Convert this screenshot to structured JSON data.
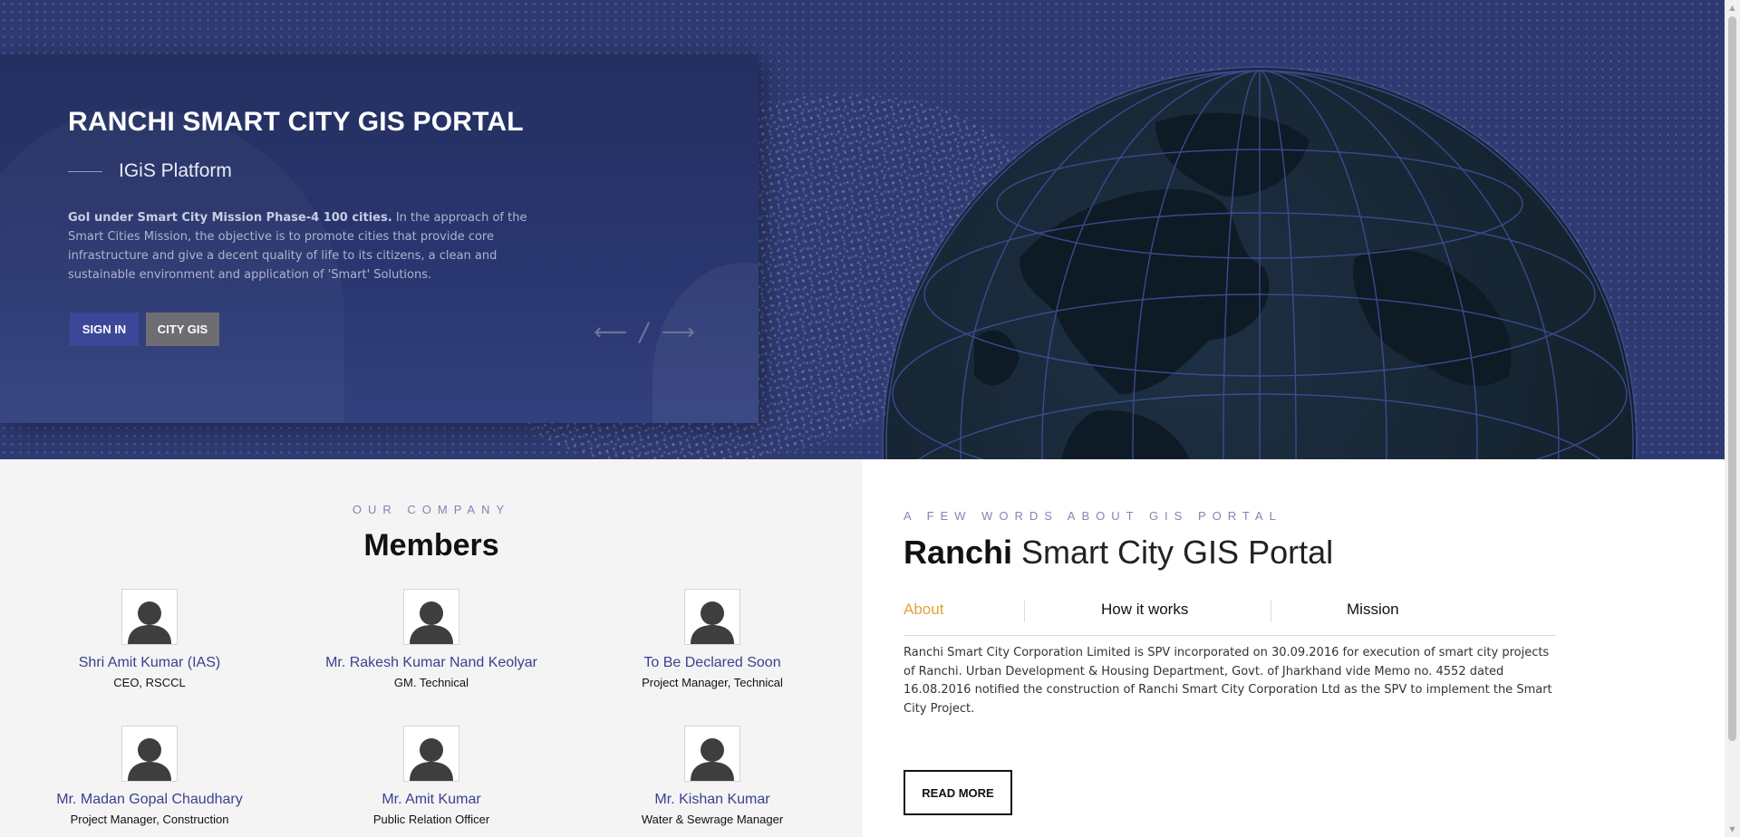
{
  "hero": {
    "title": "RANCHI SMART CITY GIS PORTAL",
    "subtitle": "IGiS Platform",
    "desc_bold": "GoI under Smart City Mission Phase-4 100 cities.",
    "desc_text": " In the approach of the Smart Cities Mission, the objective is to promote cities that provide core infrastructure and give a decent quality of life to its citizens, a clean and sustainable environment and application of 'Smart' Solutions.",
    "buttons": {
      "signin": "SIGN IN",
      "citygis": "CITY GIS"
    },
    "nav": {
      "prev": "⟵",
      "slash": "/",
      "next": "⟶"
    }
  },
  "members": {
    "eyebrow": "OUR COMPANY",
    "title": "Members",
    "items": [
      {
        "name": "Shri Amit Kumar (IAS)",
        "role": "CEO, RSCCL"
      },
      {
        "name": "Mr. Rakesh Kumar Nand Keolyar",
        "role": "GM. Technical"
      },
      {
        "name": "To Be Declared Soon",
        "role": "Project Manager, Technical"
      },
      {
        "name": "Mr. Madan Gopal Chaudhary",
        "role": "Project Manager, Construction"
      },
      {
        "name": "Mr. Amit Kumar",
        "role": "Public Relation Officer"
      },
      {
        "name": "Mr. Kishan Kumar",
        "role": "Water & Sewrage Manager"
      }
    ]
  },
  "about": {
    "eyebrow": "A FEW WORDS ABOUT GIS PORTAL",
    "title_bold": "Ranchi",
    "title_rest": " Smart City GIS Portal",
    "tabs": [
      "About",
      "How it works",
      "Mission"
    ],
    "active_tab": "About",
    "text": "Ranchi Smart City Corporation Limited is SPV incorporated on 30.09.2016 for execution of smart city projects of Ranchi. Urban Development & Housing Department, Govt. of Jharkhand vide Memo no. 4552 dated 16.08.2016 notified the construction of Ranchi Smart City Corporation Ltd as the SPV to implement the Smart City Project.",
    "read_more": "READ MORE"
  },
  "colors": {
    "hero_bg": "#2f3a73",
    "accent": "#3d4799",
    "tab_active": "#e0a23c",
    "member_name": "#3b4190"
  },
  "icons": {
    "avatar": "person-silhouette-icon",
    "prev": "arrow-left-icon",
    "next": "arrow-right-icon"
  }
}
